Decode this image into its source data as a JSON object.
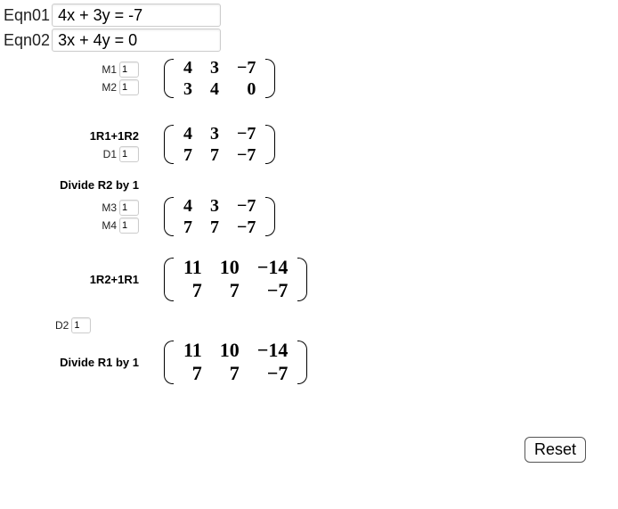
{
  "eqn": {
    "label1": "Eqn01",
    "value1": "4x + 3y = -7",
    "label2": "Eqn02",
    "value2": "3x + 4y = 0"
  },
  "stage1": {
    "m1_label": "M1",
    "m1_val": "1",
    "m2_label": "M2",
    "m2_val": "1",
    "r1c1": "4",
    "r1c2": "3",
    "r1c3": "−7",
    "r2c1": "3",
    "r2c2": "4",
    "r2c3": "0"
  },
  "stage2": {
    "op": "1R1+1R2",
    "d1_label": "D1",
    "d1_val": "1",
    "r1c1": "4",
    "r1c2": "3",
    "r1c3": "−7",
    "r2c1": "7",
    "r2c2": "7",
    "r2c3": "−7"
  },
  "stage3": {
    "op": "Divide R2 by 1",
    "m3_label": "M3",
    "m3_val": "1",
    "m4_label": "M4",
    "m4_val": "1",
    "r1c1": "4",
    "r1c2": "3",
    "r1c3": "−7",
    "r2c1": "7",
    "r2c2": "7",
    "r2c3": "−7"
  },
  "stage4": {
    "op": "1R2+1R1",
    "r1c1": "11",
    "r1c2": "10",
    "r1c3": "−14",
    "r2c1": "7",
    "r2c2": "7",
    "r2c3": "−7"
  },
  "stage5": {
    "d2_label": "D2",
    "d2_val": "1",
    "op": "Divide R1 by 1",
    "r1c1": "11",
    "r1c2": "10",
    "r1c3": "−14",
    "r2c1": "7",
    "r2c2": "7",
    "r2c3": "−7"
  },
  "reset_label": "Reset"
}
